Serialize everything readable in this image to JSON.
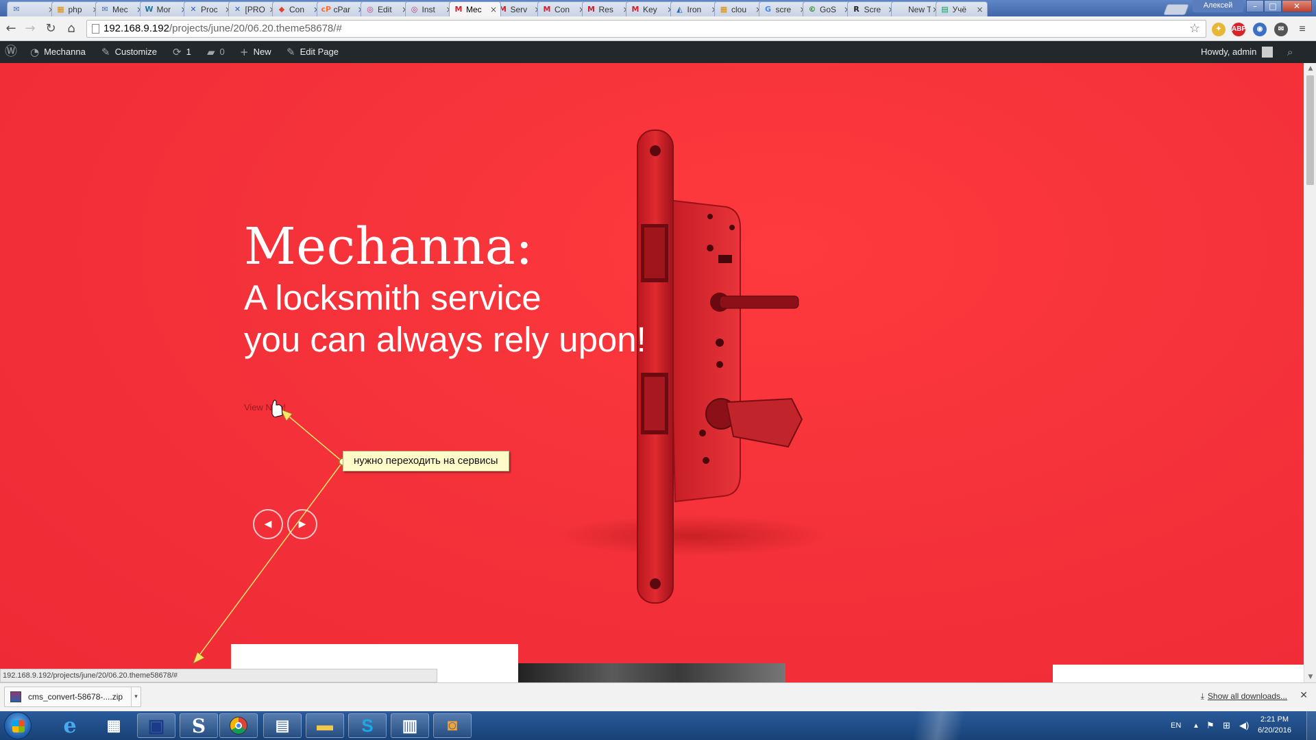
{
  "browser": {
    "tabs": [
      {
        "label": "",
        "icon": "mail-icon",
        "icon_char": "✉",
        "icon_color": "#4a6fb0"
      },
      {
        "label": "php",
        "icon": "pma-icon",
        "icon_char": "▦",
        "icon_color": "#e08a00"
      },
      {
        "label": "Mec",
        "icon": "mail-icon",
        "icon_char": "✉",
        "icon_color": "#4a6fb0"
      },
      {
        "label": "Mor",
        "icon": "wp-icon",
        "icon_char": "W",
        "icon_color": "#21759b"
      },
      {
        "label": "Proc",
        "icon": "jira-icon",
        "icon_char": "✕",
        "icon_color": "#2a60b0"
      },
      {
        "label": "[PRO",
        "icon": "jira-icon",
        "icon_char": "✕",
        "icon_color": "#2a60b0"
      },
      {
        "label": "Con",
        "icon": "gitlab-icon",
        "icon_char": "◆",
        "icon_color": "#e24329"
      },
      {
        "label": "cPar",
        "icon": "cpanel-icon",
        "icon_char": "cP",
        "icon_color": "#ff6c2c"
      },
      {
        "label": "Edit",
        "icon": "instagram-icon",
        "icon_char": "◎",
        "icon_color": "#c13584"
      },
      {
        "label": "Inst",
        "icon": "instagram-icon",
        "icon_char": "◎",
        "icon_color": "#c13584"
      },
      {
        "label": "Mec",
        "icon": "m-icon",
        "icon_char": "M",
        "icon_color": "#d0202c",
        "active": true
      },
      {
        "label": "Serv",
        "icon": "m-icon",
        "icon_char": "M",
        "icon_color": "#d0202c"
      },
      {
        "label": "Con",
        "icon": "m-icon",
        "icon_char": "M",
        "icon_color": "#d0202c"
      },
      {
        "label": "Res",
        "icon": "m-icon",
        "icon_char": "M",
        "icon_color": "#d0202c"
      },
      {
        "label": "Key",
        "icon": "m-icon",
        "icon_char": "M",
        "icon_color": "#d0202c"
      },
      {
        "label": "Iron",
        "icon": "iron-icon",
        "icon_char": "◭",
        "icon_color": "#2a60b0"
      },
      {
        "label": "clou",
        "icon": "pma-icon",
        "icon_char": "▦",
        "icon_color": "#e08a00"
      },
      {
        "label": "scre",
        "icon": "google-icon",
        "icon_char": "G",
        "icon_color": "#4285f4"
      },
      {
        "label": "GoS",
        "icon": "gos-icon",
        "icon_char": "©",
        "icon_color": "#2a8a2a"
      },
      {
        "label": "Scre",
        "icon": "r-icon",
        "icon_char": "R",
        "icon_color": "#222"
      },
      {
        "label": "New Tal",
        "icon": "",
        "icon_char": "",
        "icon_color": "#333"
      },
      {
        "label": "Учё",
        "icon": "sheets-icon",
        "icon_char": "▤",
        "icon_color": "#0f9d58"
      }
    ],
    "window_user": "Алексей",
    "url_host": "192.168.9.192",
    "url_path": "/projects/june/20/06.20.theme58678/#",
    "status_url": "192.168.9.192/projects/june/20/06.20.theme58678/#"
  },
  "adminbar": {
    "site_name": "Mechanna",
    "customize": "Customize",
    "updates_count": "1",
    "comments_count": "0",
    "new_label": "New",
    "edit_page": "Edit Page",
    "greeting": "Howdy, admin"
  },
  "hero": {
    "title": "Mechanna:",
    "subtitle_line1": "A locksmith service",
    "subtitle_line2": "you can always rely upon!",
    "view_now": "View Now!",
    "prev_icon": "◀",
    "next_icon": "▶"
  },
  "annotation": {
    "text": "нужно переходить на сервисы",
    "color": "#fdfbc7"
  },
  "downloads": {
    "file_name": "cms_convert-58678-....zip",
    "show_all": "Show all downloads..."
  },
  "taskbar": {
    "language": "EN",
    "time": "2:21 PM",
    "date": "6/20/2016"
  },
  "colors": {
    "hero_red": "#f5323a",
    "adminbar": "#23282d"
  }
}
